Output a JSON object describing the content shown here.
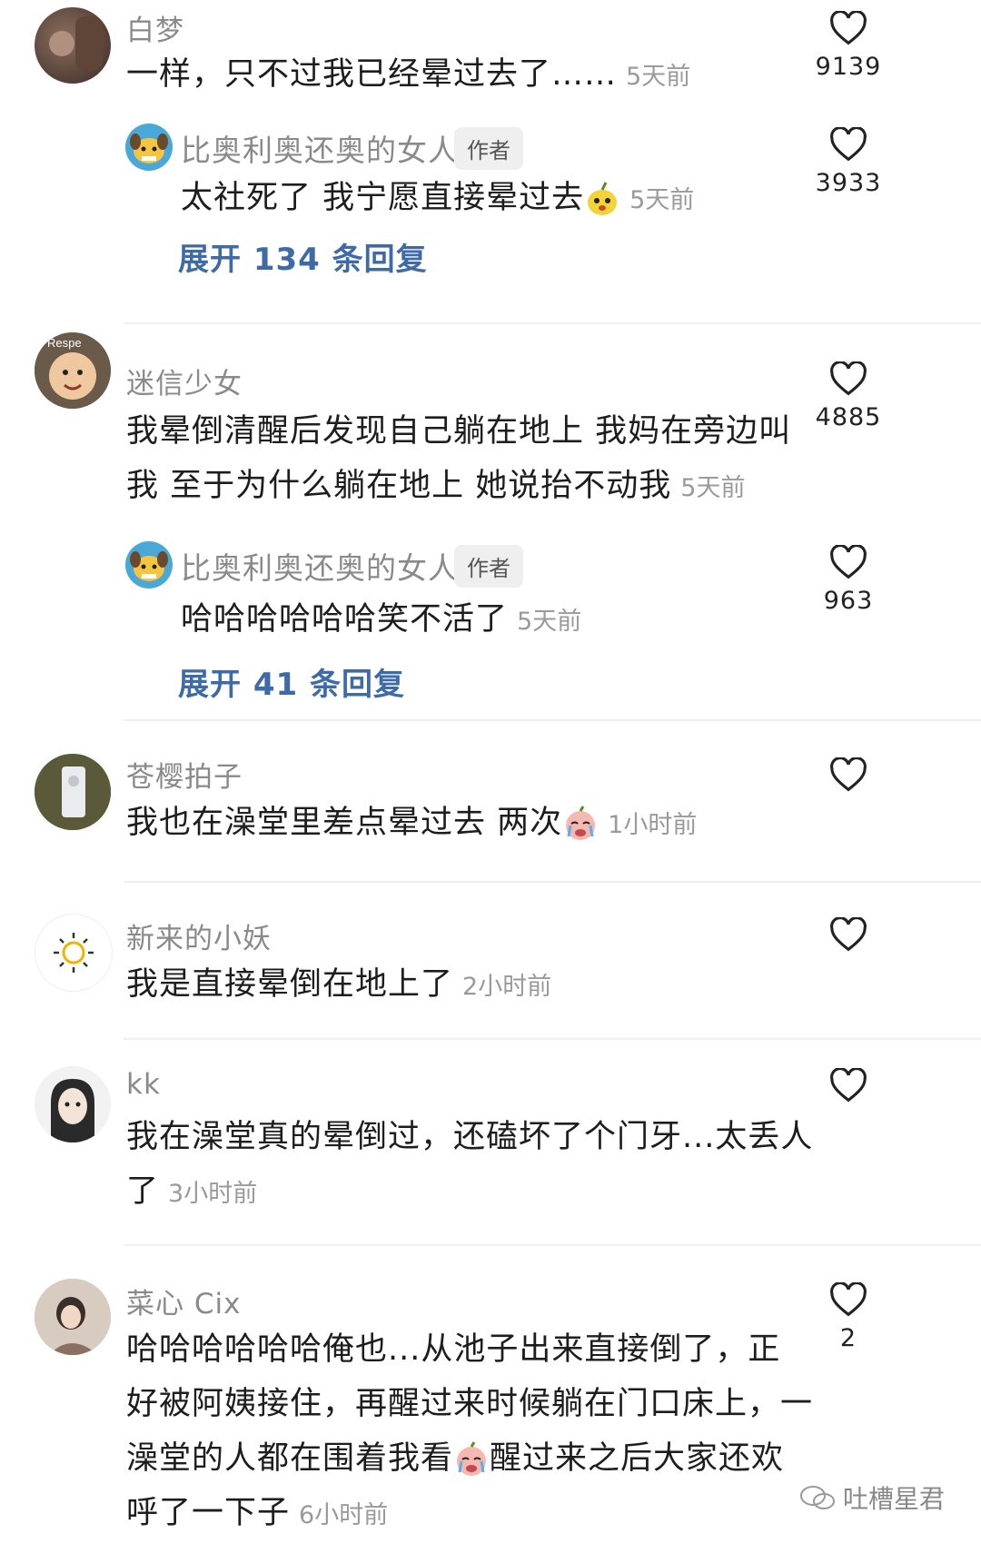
{
  "comments": [
    {
      "name": "白梦",
      "text": "一样，只不过我已经晕过去了……",
      "time": "5天前",
      "likes": "9139"
    },
    {
      "name": "比奥利奥还奥的女人",
      "badge": "作者",
      "text": "太社死了  我宁愿直接晕过去",
      "time": "5天前",
      "likes": "3933",
      "expand": "展开 134 条回复"
    },
    {
      "name": "迷信少女",
      "text_line1": "我晕倒清醒后发现自己躺在地上 我妈在旁边叫",
      "text_line2": "我 至于为什么躺在地上 她说抬不动我",
      "time": "5天前",
      "likes": "4885",
      "avatar_text": "Respe"
    },
    {
      "name": "比奥利奥还奥的女人",
      "badge": "作者",
      "text": "哈哈哈哈哈哈笑不活了",
      "time": "5天前",
      "likes": "963",
      "expand": "展开 41 条回复"
    },
    {
      "name": "苍樱拍子",
      "text": "我也在澡堂里差点晕过去 两次",
      "time": "1小时前",
      "likes": ""
    },
    {
      "name": "新来的小妖",
      "text": "我是直接晕倒在地上了",
      "time": "2小时前",
      "likes": ""
    },
    {
      "name": "kk",
      "text_line1": "我在澡堂真的晕倒过，还磕坏了个门牙...太丢人",
      "text_line2": "了",
      "time": "3小时前",
      "likes": ""
    },
    {
      "name": "菜心 Cix",
      "text_line1": "哈哈哈哈哈哈俺也...从池子出来直接倒了，正",
      "text_line2": "好被阿姨接住，再醒过来时候躺在门口床上，一",
      "text_line3a": "澡堂的人都在围着我看",
      "text_line3b": "醒过来之后大家还欢",
      "text_line4": "呼了一下子",
      "time": "6小时前",
      "likes": "2"
    }
  ],
  "watermark": "吐槽星君",
  "icons": {
    "like": "heart-outline-icon",
    "author_avatar": "yellow-dog-avatar-icon"
  }
}
